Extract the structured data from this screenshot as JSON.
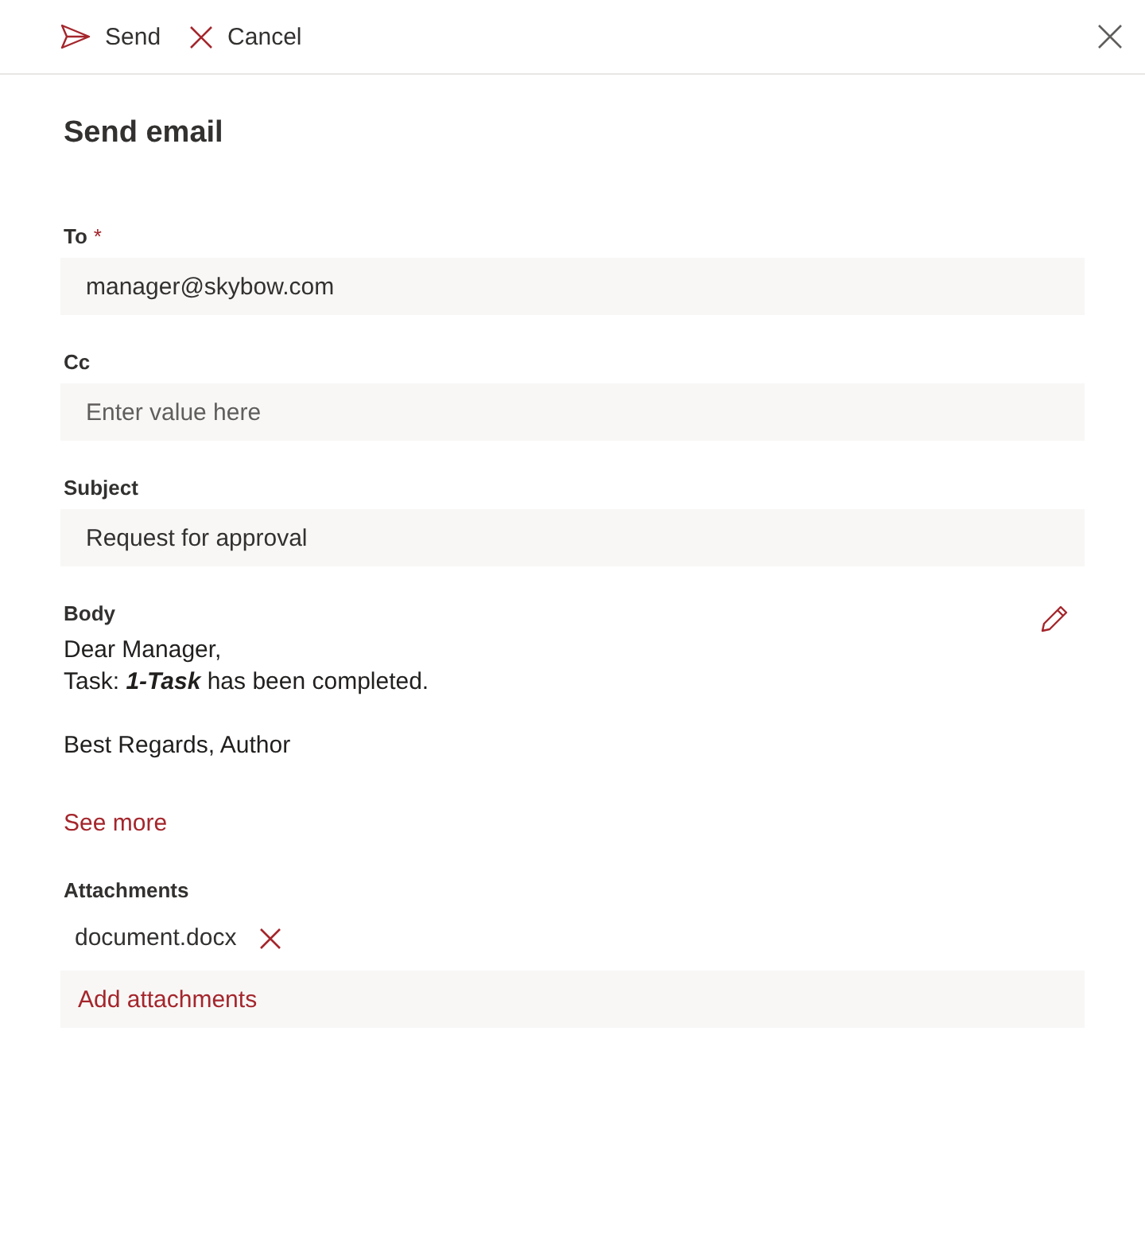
{
  "toolbar": {
    "actions": [
      {
        "kind": "send",
        "label": "Send"
      },
      {
        "kind": "cancel",
        "label": "Cancel"
      }
    ]
  },
  "title": "Send email",
  "fields": [
    {
      "label": "To",
      "required_mark": "*",
      "value": "manager@skybow.com"
    },
    {
      "label": "Cc",
      "placeholder": "Enter value here"
    },
    {
      "label": "Subject",
      "value": "Request for approval"
    }
  ],
  "body": {
    "label": "Body",
    "paragraphs": [
      [
        "Dear Manager,",
        "Task: **1-Task** has been completed."
      ],
      [
        "Best Regards, Author"
      ]
    ],
    "see_more": "See more"
  },
  "attachments": {
    "label": "Attachments",
    "files": [
      "document.docx"
    ],
    "add_button": "Add attachments"
  }
}
